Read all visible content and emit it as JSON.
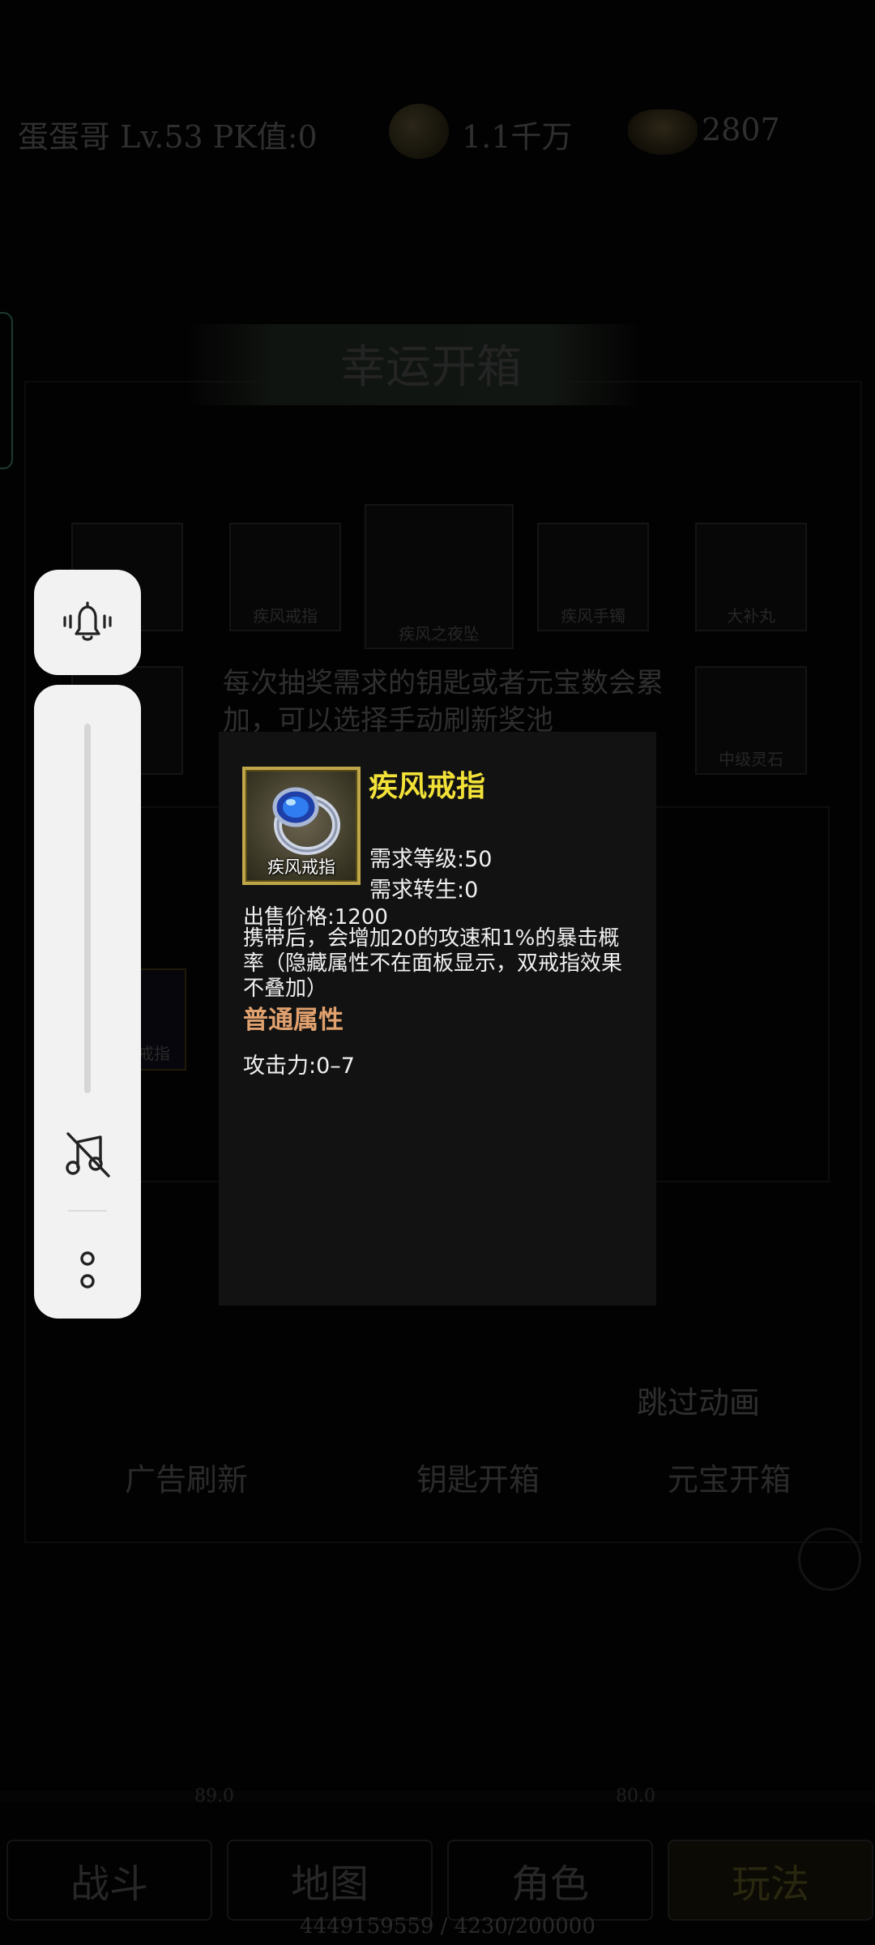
{
  "top_bar": {
    "player_info": "蛋蛋哥 Lv.53 PK值:0",
    "gold": "1.1千万",
    "ingot": "2807"
  },
  "chest_panel": {
    "title": "幸运开箱",
    "slots": [
      {
        "label": ""
      },
      {
        "label": "疾风戒指"
      },
      {
        "label": "疾风之夜坠"
      },
      {
        "label": "疾风手镯"
      },
      {
        "label": "大补丸"
      },
      {
        "label": ""
      },
      {
        "label": "中级灵石"
      }
    ],
    "description": "每次抽奖需求的钥匙或者元宝数会累加，可以选择手动刷新奖池",
    "partial_item_label": "戒指"
  },
  "actions": {
    "skip_animation": "跳过动画",
    "ad_refresh": "广告刷新",
    "key_open": "钥匙开箱",
    "ingot_open": "元宝开箱"
  },
  "exp": {
    "left": "89.0",
    "right": "80.0"
  },
  "bottom_nav": {
    "tabs": [
      "战斗",
      "地图",
      "角色",
      "玩法"
    ],
    "coords": "4449159559 / 4230/200000"
  },
  "tooltip": {
    "item_name": "疾风戒指",
    "icon_caption": "疾风戒指",
    "required_level": "需求等级:50",
    "required_rebirth": "需求转生:0",
    "sell_price": "出售价格:1200",
    "description": "携带后，会增加20的攻速和1%的暴击概率（隐藏属性不在面板显示，双戒指效果不叠加）",
    "attribute_header": "普通属性",
    "attack": "攻击力:0–7",
    "colors": {
      "name": "#f2e238",
      "attribute_header": "#e0a16e",
      "background": "#121212",
      "frame": "#bfa648"
    }
  },
  "floating_toolbar": {
    "icons": [
      "bell-vibrate-icon",
      "music-off-icon",
      "more-options-icon"
    ]
  }
}
